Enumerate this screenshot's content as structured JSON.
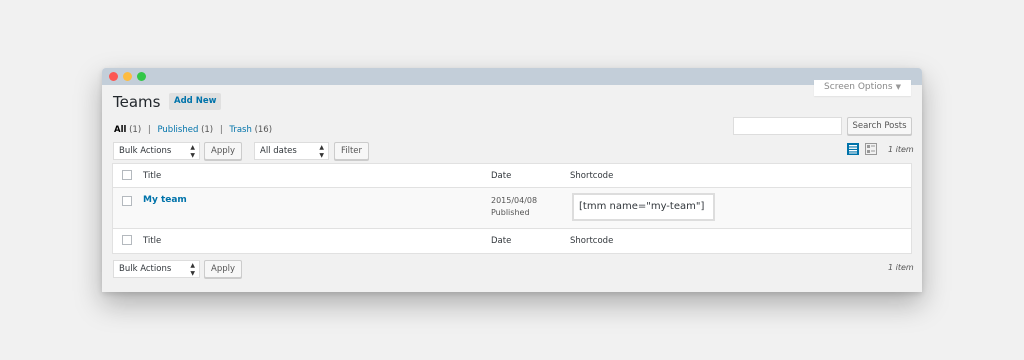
{
  "window": {
    "traffic_lights": [
      "close",
      "minimize",
      "zoom"
    ]
  },
  "screen_options": {
    "label": "Screen Options"
  },
  "header": {
    "title": "Teams",
    "add_new": "Add New"
  },
  "views": {
    "all_label": "All",
    "all_count": "(1)",
    "published_label": "Published",
    "published_count": "(1)",
    "trash_label": "Trash",
    "trash_count": "(16)",
    "separator": "|"
  },
  "search": {
    "value": "",
    "placeholder": "",
    "button": "Search Posts"
  },
  "top_nav": {
    "bulk_actions": "Bulk Actions",
    "apply": "Apply",
    "dates": "All dates",
    "filter": "Filter",
    "items": "1 item"
  },
  "view_modes": [
    "list-view-icon",
    "excerpt-view-icon"
  ],
  "table": {
    "columns": [
      "Title",
      "Date",
      "Shortcode"
    ],
    "rows": [
      {
        "title": "My team",
        "date": "2015/04/08",
        "status": "Published",
        "shortcode": "[tmm name=\"my-team\"]"
      }
    ]
  },
  "bottom_nav": {
    "bulk_actions": "Bulk Actions",
    "apply": "Apply",
    "items": "1 item"
  },
  "colors": {
    "link": "#0073aa",
    "titlebar": "#c3ced9",
    "background": "#f1f1f1"
  }
}
